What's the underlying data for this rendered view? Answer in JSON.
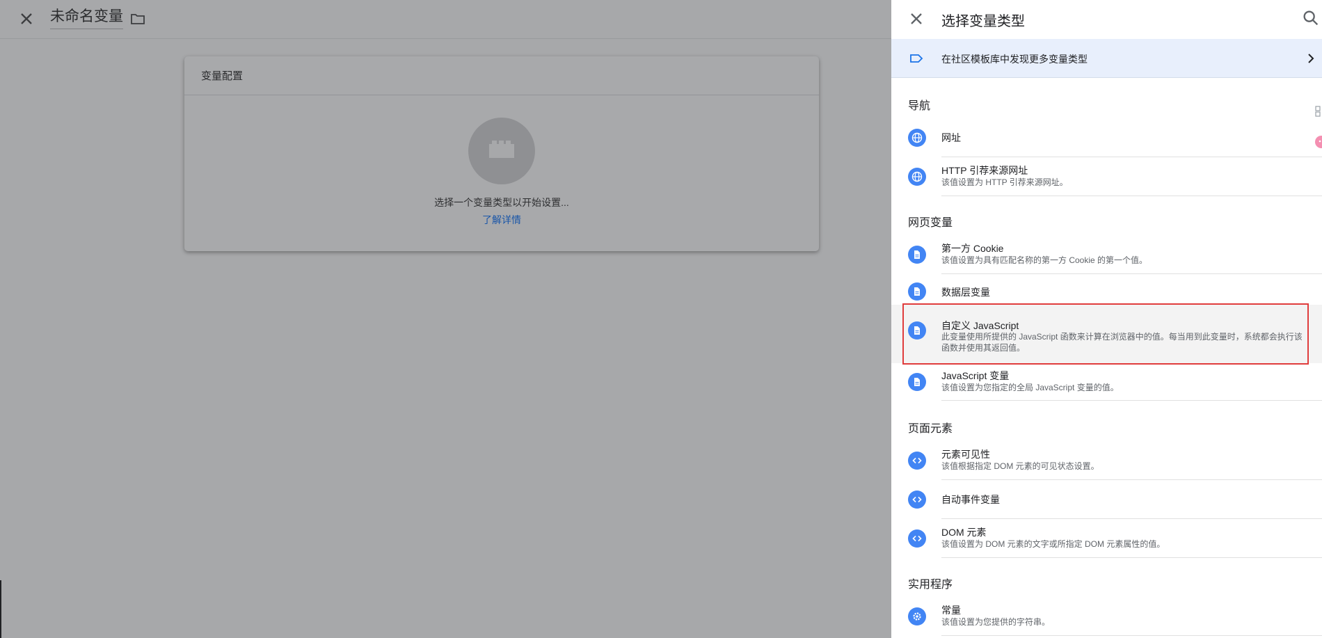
{
  "editor": {
    "title": "未命名变量",
    "card_title": "变量配置",
    "hint": "选择一个变量类型以开始设置...",
    "learn_more": "了解详情"
  },
  "panel": {
    "title": "选择变量类型",
    "community_label": "在社区模板库中发现更多变量类型",
    "sections": {
      "nav": "导航",
      "page_vars": "网页变量",
      "page_elements": "页面元素",
      "utilities": "实用程序"
    },
    "items": [
      {
        "title": "网址",
        "desc": "",
        "icon": "globe-icon"
      },
      {
        "title": "HTTP 引荐来源网址",
        "desc": "该值设置为 HTTP 引荐来源网址。",
        "icon": "globe-icon"
      },
      {
        "title": "第一方 Cookie",
        "desc": "该值设置为具有匹配名称的第一方 Cookie 的第一个值。",
        "icon": "document-icon"
      },
      {
        "title": "数据层变量",
        "desc": "",
        "icon": "document-icon"
      },
      {
        "title": "自定义 JavaScript",
        "desc": "此变量使用所提供的 JavaScript 函数来计算在浏览器中的值。每当用到此变量时，系统都会执行该函数并使用其返回值。",
        "icon": "document-icon"
      },
      {
        "title": "JavaScript 变量",
        "desc": "该值设置为您指定的全局 JavaScript 变量的值。",
        "icon": "document-icon"
      },
      {
        "title": "元素可见性",
        "desc": "该值根据指定 DOM 元素的可见状态设置。",
        "icon": "code-icon"
      },
      {
        "title": "自动事件变量",
        "desc": "",
        "icon": "code-icon"
      },
      {
        "title": "DOM 元素",
        "desc": "该值设置为 DOM 元素的文字或所指定 DOM 元素属性的值。",
        "icon": "code-icon"
      },
      {
        "title": "常量",
        "desc": "该值设置为您提供的字符串。",
        "icon": "gear-icon"
      }
    ]
  },
  "colors": {
    "accent": "#4285f4",
    "highlight_border": "#e03c3c",
    "community_bg": "#e8effc",
    "overlay": "#a7a8aa"
  }
}
